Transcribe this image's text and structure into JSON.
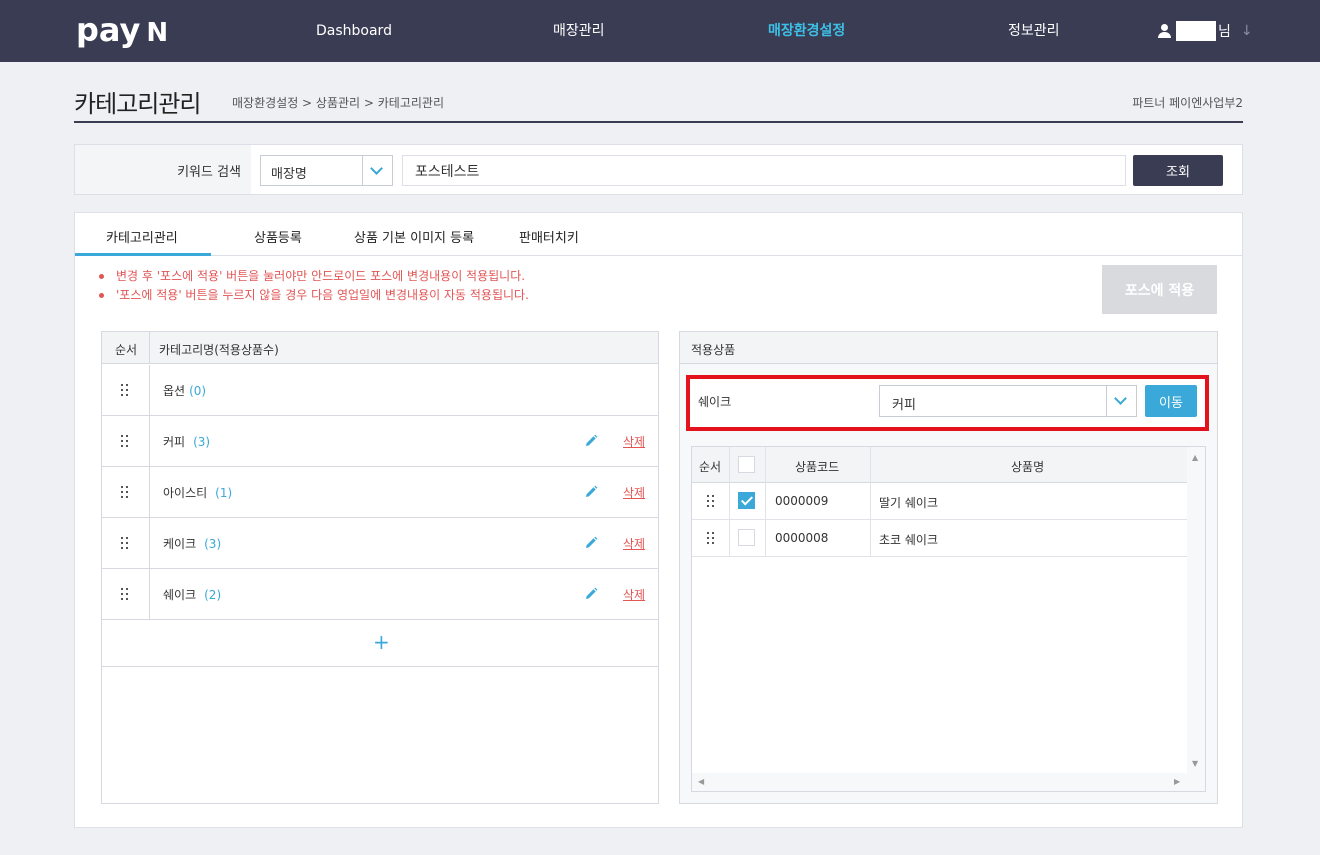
{
  "header": {
    "logo": "pay",
    "logo_n": "N",
    "nav": [
      "Dashboard",
      "매장관리",
      "매장환경설정",
      "정보관리"
    ],
    "active_nav": "매장환경설정",
    "user_suffix": "님"
  },
  "page": {
    "title": "카테고리관리",
    "breadcrumb": "매장환경설정 > 상품관리 > 카테고리관리",
    "partner": "파트너 페이엔사업부2"
  },
  "search": {
    "label": "키워드 검색",
    "type_value": "매장명",
    "keyword": "포스테스트",
    "button": "조회"
  },
  "tabs": [
    "카테고리관리",
    "상품등록",
    "상품 기본 이미지 등록",
    "판매터치키"
  ],
  "notices": [
    "변경 후 '포스에 적용' 버튼을 눌러야만 안드로이드 포스에 변경내용이 적용됩니다.",
    "'포스에 적용' 버튼을 누르지 않을 경우 다음 영업일에 변경내용이 자동 적용됩니다."
  ],
  "pos_apply_button": "포스에 적용",
  "category_table": {
    "headers": [
      "순서",
      "카테고리명(적용상품수)"
    ],
    "delete_label": "삭제",
    "add_label": "+",
    "rows": [
      {
        "name": "옵션",
        "count": "(0)"
      },
      {
        "name": "커피",
        "count": "(3)"
      },
      {
        "name": "아이스티",
        "count": "(1)"
      },
      {
        "name": "케이크",
        "count": "(3)"
      },
      {
        "name": "쉐이크",
        "count": "(2)"
      }
    ]
  },
  "product_panel": {
    "title": "적용상품",
    "selected_category": "쉐이크",
    "move_target": "커피",
    "move_button": "이동",
    "headers": [
      "순서",
      "상품코드",
      "상품명"
    ],
    "rows": [
      {
        "code": "0000009",
        "name": "딸기 쉐이크",
        "checked": true
      },
      {
        "code": "0000008",
        "name": "초코 쉐이크",
        "checked": false
      }
    ]
  },
  "colors": {
    "header_bg": "#3a3c54",
    "accent": "#3aa8d8",
    "alert": "#e25555",
    "highlight_border": "#e3121d"
  }
}
